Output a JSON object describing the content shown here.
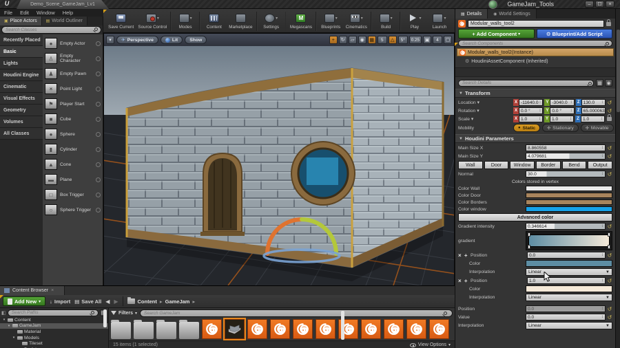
{
  "window": {
    "logo": "U",
    "tab_title": "Demo_Scene_GameJam_Lv1",
    "app_title": "GameJam_Tools",
    "menu": [
      "File",
      "Edit",
      "Window",
      "Help"
    ],
    "controls": {
      "minimize": "–",
      "maximize": "☐",
      "close": "×"
    }
  },
  "main_toolbar": {
    "buttons": [
      {
        "id": "save-current",
        "label": "Save Current",
        "icon": "save-icon",
        "dropdown": false,
        "sep_after": false
      },
      {
        "id": "source-control",
        "label": "Source Control",
        "icon": "source-control-icon",
        "dropdown": true,
        "sep_after": true
      },
      {
        "id": "modes",
        "label": "Modes",
        "icon": "modes-icon",
        "dropdown": true,
        "sep_after": true
      },
      {
        "id": "content",
        "label": "Content",
        "icon": "content-icon",
        "dropdown": false,
        "sep_after": false
      },
      {
        "id": "marketplace",
        "label": "Marketplace",
        "icon": "marketplace-icon",
        "dropdown": false,
        "sep_after": true
      },
      {
        "id": "settings",
        "label": "Settings",
        "icon": "settings-icon",
        "dropdown": true,
        "sep_after": true
      },
      {
        "id": "megascans",
        "label": "Megascans",
        "icon": "megascans-icon",
        "dropdown": false,
        "sep_after": true
      },
      {
        "id": "blueprints",
        "label": "Blueprints",
        "icon": "blueprints-icon",
        "dropdown": true,
        "sep_after": false
      },
      {
        "id": "cinematics",
        "label": "Cinematics",
        "icon": "cinematics-icon",
        "dropdown": true,
        "sep_after": true
      },
      {
        "id": "build",
        "label": "Build",
        "icon": "build-icon",
        "dropdown": true,
        "sep_after": true
      },
      {
        "id": "play",
        "label": "Play",
        "icon": "play-icon",
        "dropdown": true,
        "sep_after": false
      },
      {
        "id": "launch",
        "label": "Launch",
        "icon": "launch-icon",
        "dropdown": true,
        "sep_after": false
      }
    ]
  },
  "place_panel": {
    "tabs": [
      {
        "label": "Place Actors",
        "active": true
      },
      {
        "label": "World Outliner",
        "active": false
      }
    ],
    "search_placeholder": "Search Classes",
    "categories": [
      {
        "label": "Recently Placed",
        "active": false
      },
      {
        "label": "Basic",
        "active": true
      },
      {
        "label": "Lights",
        "active": false
      },
      {
        "label": "Houdini Engine",
        "active": false
      },
      {
        "label": "Cinematic",
        "active": false
      },
      {
        "label": "Visual Effects",
        "active": false
      },
      {
        "label": "Geometry",
        "active": false
      },
      {
        "label": "Volumes",
        "active": false
      },
      {
        "label": "All Classes",
        "active": false
      }
    ],
    "items": [
      {
        "label": "Empty Actor",
        "icon": "sphere-icon",
        "glyph": "●"
      },
      {
        "label": "Empty Character",
        "icon": "character-icon",
        "glyph": "♙"
      },
      {
        "label": "Empty Pawn",
        "icon": "pawn-icon",
        "glyph": "♟"
      },
      {
        "label": "Point Light",
        "icon": "light-icon",
        "glyph": "☀"
      },
      {
        "label": "Player Start",
        "icon": "flag-icon",
        "glyph": "⚑"
      },
      {
        "label": "Cube",
        "icon": "cube-icon",
        "glyph": "■"
      },
      {
        "label": "Sphere",
        "icon": "sphere-icon",
        "glyph": "●"
      },
      {
        "label": "Cylinder",
        "icon": "cylinder-icon",
        "glyph": "▮"
      },
      {
        "label": "Cone",
        "icon": "cone-icon",
        "glyph": "▲"
      },
      {
        "label": "Plane",
        "icon": "plane-icon",
        "glyph": "▬"
      },
      {
        "label": "Box Trigger",
        "icon": "box-trigger-icon",
        "glyph": "□"
      },
      {
        "label": "Sphere Trigger",
        "icon": "sphere-trigger-icon",
        "glyph": "○"
      }
    ]
  },
  "viewport": {
    "mode_button": "Perspective",
    "lit_button": "Lit",
    "show_button": "Show",
    "snap": {
      "grid": "5",
      "angle": "5°",
      "scale": "0.25",
      "camera_speed": "4"
    }
  },
  "details": {
    "tabs": [
      {
        "label": "Details",
        "active": true
      },
      {
        "label": "World Settings",
        "active": false
      }
    ],
    "actor_name": "Modular_walls_tool2",
    "add_component_label": "Add Component",
    "blueprint_label": "Blueprint/Add Script",
    "search_components_placeholder": "Search Components",
    "components": [
      {
        "label": "Modular_walls_tool2(Instance)",
        "selected": true
      },
      {
        "label": "HoudiniAssetComponent (Inherited)",
        "selected": false
      }
    ],
    "search_details_placeholder": "Search Details",
    "transform": {
      "header": "Transform",
      "location_label": "Location",
      "rotation_label": "Rotation",
      "scale_label": "Scale",
      "mobility_label": "Mobility",
      "location": {
        "x": "-11640.0",
        "y": "-3040.0",
        "z": "130.0"
      },
      "rotation": {
        "x": "0.0 °",
        "y": "0.0 °",
        "z": "65.000063"
      },
      "scale": {
        "x": "1.0",
        "y": "1.0",
        "z": "1.0"
      },
      "mobility": [
        {
          "label": "Static",
          "active": true
        },
        {
          "label": "Stationary",
          "active": false
        },
        {
          "label": "Movable",
          "active": false
        }
      ]
    },
    "houdini": {
      "header": "Houdini Parameters",
      "main_size_x_label": "Main Size X",
      "main_size_x": "8.860558",
      "main_size_y_label": "Main Size Y",
      "main_size_y": "4.079681",
      "tabs": [
        "Wall",
        "Door",
        "Window",
        "Border",
        "Bend",
        "Output"
      ],
      "normal_label": "Normal",
      "normal": "30.0",
      "vertex_note": "Colors stored in vertex",
      "colors": [
        {
          "label": "Color Wall",
          "hex": "#e9e9e9"
        },
        {
          "label": "Color Door",
          "hex": "#a8845c"
        },
        {
          "label": "Color Borders",
          "hex": "#a8845c"
        },
        {
          "label": "Color window",
          "hex": "#18a2e8"
        }
      ],
      "advanced_label": "Advanced color",
      "gradient_intensity_label": "Gradient intensity",
      "gradient_intensity": "0.346614",
      "gradient_label": "gradient",
      "gradient_from": "#5d8da3",
      "gradient_to": "#f5e9d8",
      "stops": [
        {
          "position_label": "Position",
          "position": "0.0",
          "color_label": "Color",
          "color": "#5d8da3",
          "interpolation_label": "Interpolation",
          "interpolation": "Linear"
        },
        {
          "position_label": "Position",
          "position": "1.0",
          "color_label": "Color",
          "color": "#f5e9d8",
          "interpolation_label": "Interpolation",
          "interpolation": "Linear"
        }
      ],
      "extra": {
        "position_label": "Position",
        "position": "0.0",
        "value_label": "Value",
        "value": "0.0",
        "interpolation_label": "Interpolation",
        "interpolation": "Linear"
      }
    }
  },
  "content_browser": {
    "tab_label": "Content Browser",
    "add_new_label": "Add New",
    "import_label": "Import",
    "save_all_label": "Save All",
    "breadcrumbs": [
      "Content",
      "GameJam"
    ],
    "search_paths_placeholder": "Search Paths",
    "filters_label": "Filters",
    "search_placeholder": "Search GameJam",
    "tree": [
      {
        "label": "Content",
        "depth": 0,
        "expanded": true,
        "selected": false
      },
      {
        "label": "GameJam",
        "depth": 1,
        "expanded": true,
        "selected": true
      },
      {
        "label": "Material",
        "depth": 2,
        "expanded": false,
        "selected": false
      },
      {
        "label": "Models",
        "depth": 2,
        "expanded": true,
        "selected": false
      },
      {
        "label": "Tileset",
        "depth": 3,
        "expanded": false,
        "selected": false
      },
      {
        "label": "Prefabs",
        "depth": 2,
        "expanded": false,
        "selected": false
      }
    ],
    "assets": {
      "types": [
        "folder",
        "folder",
        "folder",
        "folder",
        "hda",
        "hda-selected",
        "hda",
        "hda",
        "hda",
        "hda",
        "hda",
        "hda",
        "hda",
        "hda",
        "hda"
      ]
    },
    "status": "15 items (1 selected)",
    "view_options_label": "View Options"
  }
}
